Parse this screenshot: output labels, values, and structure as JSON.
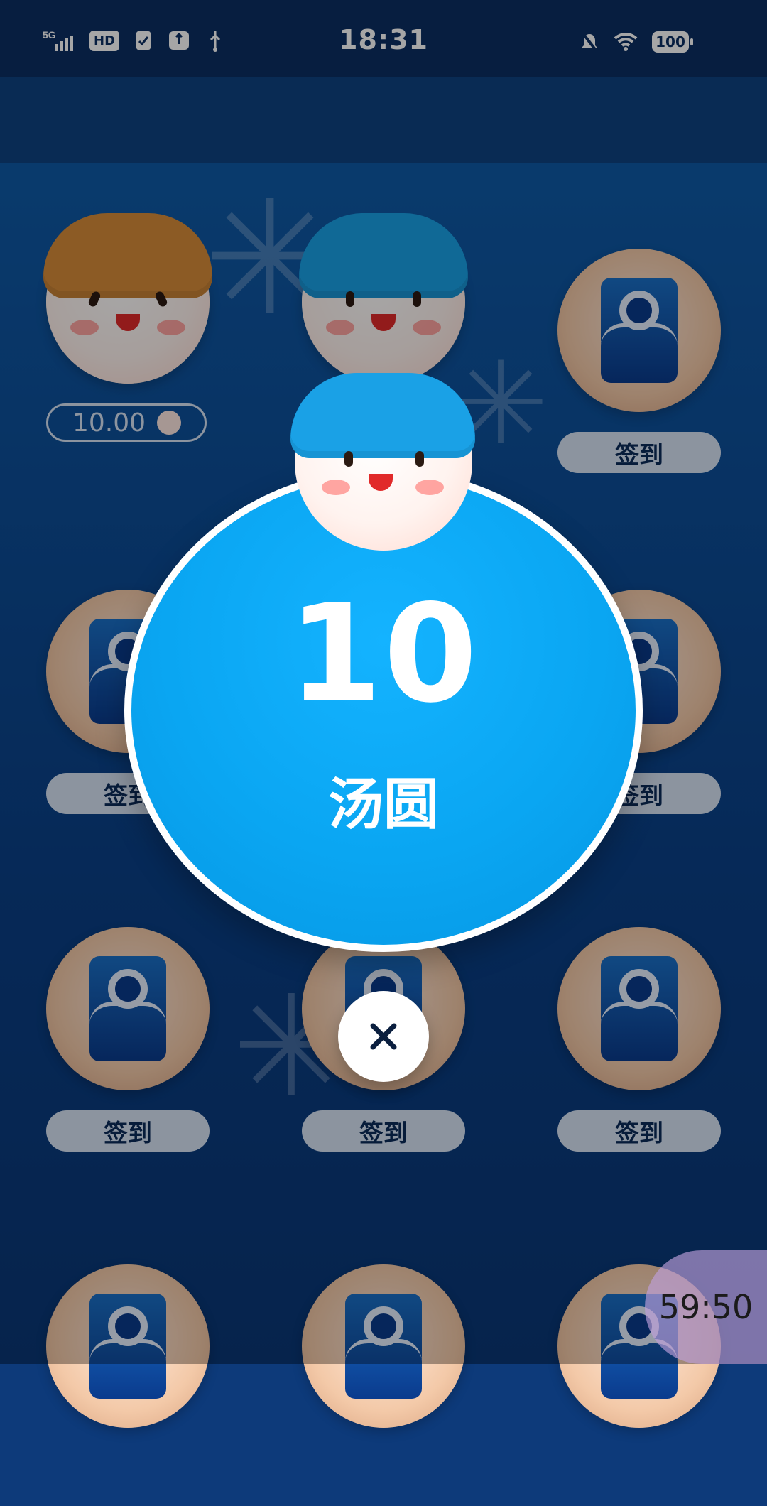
{
  "status_bar": {
    "network": "5G",
    "hd_label": "HD",
    "time": "18:31",
    "battery": "100"
  },
  "grid": {
    "checkin_label": "签到",
    "first_amount": "10.00"
  },
  "popup": {
    "value": "10",
    "unit": "汤圆",
    "close_icon": "close-icon"
  },
  "timer": {
    "text": "59:50"
  }
}
